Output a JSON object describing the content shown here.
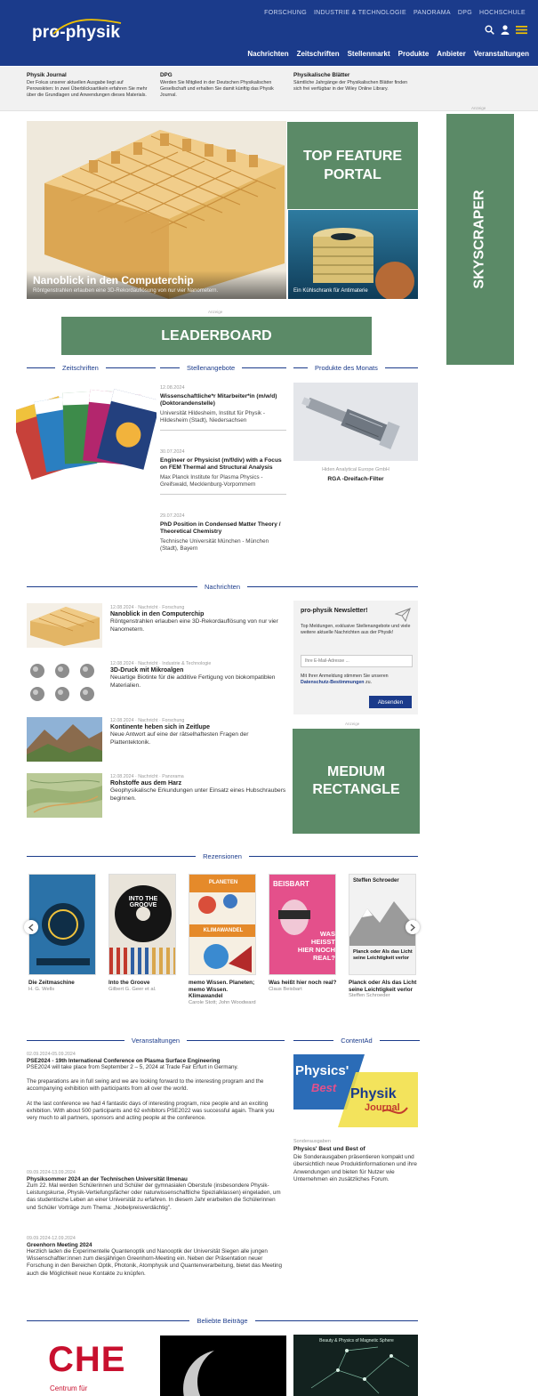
{
  "header": {
    "logo": "pro-physik",
    "top_links": [
      "FORSCHUNG",
      "INDUSTRIE & TECHNOLOGIE",
      "PANORAMA",
      "DPG",
      "HOCHSCHULE"
    ],
    "main_nav": [
      "Nachrichten",
      "Zeitschriften",
      "Stellenmarkt",
      "Produkte",
      "Anbieter",
      "Veranstaltungen"
    ]
  },
  "journal_strip": [
    {
      "title": "Physik Journal",
      "text": "Der Fokus unserer aktuellen Ausgabe liegt auf Perowskiten: In zwei Überblicksartikeln erfahren Sie mehr über die Grundlagen und Anwendungen dieses Materials."
    },
    {
      "title": "DPG",
      "text": "Werden Sie Mitglied in der Deutschen Physikalischen Gesellschaft und erhalten Sie damit künftig das Physik Journal."
    },
    {
      "title": "Physikalische Blätter",
      "text": "Sämtliche Jahrgänge der Physikalischen Blätter finden sich frei verfügbar in der Wiley Online Library."
    }
  ],
  "ad_label": "Anzeige",
  "feature": {
    "main_title": "Nanoblick in den Computerchip",
    "main_subtitle": "Röntgenstrahlen erlauben eine 3D-Rekordauflösung von nur vier Nanometern.",
    "side_caption": "Ein Kühlschrank für Antimaterie"
  },
  "ads": {
    "top_feature": "TOP FEATURE PORTAL",
    "skyscraper": "SKYSCRAPER",
    "leaderboard": "LEADERBOARD",
    "medium_rectangle": "MEDIUM RECTANGLE"
  },
  "sections": {
    "zeitschriften": "Zeitschriften",
    "stellenangebote": "Stellenangebote",
    "produkte": "Produkte des Monats",
    "nachrichten": "Nachrichten",
    "rezensionen": "Rezensionen",
    "veranstaltungen": "Veranstaltungen",
    "contentad": "ContentAd",
    "beliebte": "Beliebte Beiträge"
  },
  "jobs": [
    {
      "date": "12.08.2024",
      "title": "Wissenschaftliche*r Mitarbeiter*in (m/w/d) (Doktorandenstelle)",
      "org": "Universität Hildesheim, Institut für Physik - Hildesheim (Stadt), Niedersachsen"
    },
    {
      "date": "30.07.2024",
      "title": "Engineer or Physicist (m/f/div) with a Focus on FEM Thermal and Structural Analysis",
      "org": "Max Planck Institute for Plasma Physics - Greifswald, Mecklenburg-Vorpommern"
    },
    {
      "date": "29.07.2024",
      "title": "PhD Position in Condensed Matter Theory / Theoretical Chemistry",
      "org": "Technische Universität München - München (Stadt), Bayern"
    }
  ],
  "product": {
    "vendor": "Hiden Analytical Europe GmbH",
    "name": "RGA -Dreifach-Filter"
  },
  "news": [
    {
      "meta": "12.08.2024 · Nachricht · Forschung",
      "title": "Nanoblick in den Computerchip",
      "desc": "Röntgenstrahlen erlauben eine 3D-Rekordauflösung von nur vier Nanometern."
    },
    {
      "meta": "12.08.2024 · Nachricht · Industrie & Technologie",
      "title": "3D-Druck mit Mikroalgen",
      "desc": "Neuartige Biotinte für die additive Fertigung von biokompatiblen Materialien."
    },
    {
      "meta": "12.08.2024 · Nachricht · Forschung",
      "title": "Kontinente heben sich in Zeitlupe",
      "desc": "Neue Antwort auf eine der rätselhaftesten Fragen der Plattentektonik."
    },
    {
      "meta": "12.08.2024 · Nachricht · Panorama",
      "title": "Rohstoffe aus dem Harz",
      "desc": "Geophysikalische Erkundungen unter Einsatz eines Hubschraubers beginnen."
    }
  ],
  "newsletter": {
    "title": "pro-physik Newsletter!",
    "text": "Top Meldungen, exklusive Stellenangebote und viele weitere aktuelle Nachrichten aus der Physik!",
    "placeholder": "Ihre E-Mail-Adresse ...",
    "consent_prefix": "Mit Ihrer Anmeldung stimmen Sie unseren",
    "consent_link": "Datenschutz-Bestimmungen",
    "consent_suffix": "zu.",
    "button": "Absenden"
  },
  "books": [
    {
      "title": "Die Zeitmaschine",
      "author": "H. G. Wells"
    },
    {
      "title": "Into the Groove",
      "author": "Gilbert G. Geer et al."
    },
    {
      "title": "memo Wissen. Planeten; memo Wissen. Klimawandel",
      "author": "Carole Stott; John Woodward"
    },
    {
      "title": "Was heißt hier noch real?",
      "author": "Claus Beisbart"
    },
    {
      "title": "Planck oder Als das Licht seine Leichtigkeit verlor",
      "author": "Steffen Schroeder"
    }
  ],
  "book_covers": {
    "groove": "INTO THE GROOVE",
    "planeten": "PLANETEN",
    "klima": "KLIMAWANDEL",
    "beisbart_author": "BEISBART",
    "beisbart_title": "WAS HEISST HIER NOCH REAL?",
    "schroeder_author": "Steffen Schroeder",
    "schroeder_title": "Planck oder Als das Licht seine Leichtigkeit verlor"
  },
  "events": [
    {
      "date": "02.09.2024-05.09.2024",
      "title": "PSE2024 - 19th International Conference on Plasma Surface Engineering",
      "paras": [
        "PSE2024 will take place from September 2 – 5, 2024 at Trade Fair Erfurt in Germany.",
        "The preparations are in full swing and we are looking forward to the interesting program and the accompanying exhibition with participants from all over the world.",
        "At the last conference we had 4 fantastic days of interesting program, nice people and an exciting exhibition. With about 500 participants and 62 exhibitors PSE2022 was successful again. Thank you very much to all partners, sponsors and acting people at the conference."
      ]
    },
    {
      "date": "09.09.2024-13.09.2024",
      "title": "Physiksommer 2024 an der Technischen Universität Ilmenau",
      "paras": [
        "Zum 22. Mal werden Schülerinnen und Schüler der gymnasialen Oberstufe (insbesondere Physik-Leistungskurse, Physik-Vertiefungsfächer oder naturwissenschaftliche Spezialklassen) eingeladen, um das studentische Leben an einer Universität zu erfahren. In diesem Jahr erarbeiten die Schülerinnen und Schüler Vorträge zum Thema: „Nobelpreisverdächtig\"."
      ]
    },
    {
      "date": "09.09.2024-12.09.2024",
      "title": "Greenhorn Meeting 2024",
      "paras": [
        "Herzlich laden die Experimentelle Quantenoptik und Nanooptik der Universität Siegen alle jungen Wissenschaftler:innen zum diesjährigen Greenhorn-Meeting ein. Neben der Präsentation neuer Forschung in den Bereichen Optik, Photonik, Atomphysik und Quantenverarbeitung, bietet das Meeting auch die Möglichkeit neue Kontakte zu knüpfen."
      ]
    }
  ],
  "contentad": {
    "logo_line1": "Physics'",
    "logo_line2": "Best",
    "logo_line3": "Physik",
    "logo_line4": "Journal",
    "category": "Sonderausgaben",
    "title": "Physics' Best und Best of",
    "desc": "Die Sonderausgaben präsentieren kompakt und übersichtlich neue Produktinformationen und ihre Anwendungen und bieten für Nutzer wie Unternehmen ein zusätzliches Forum."
  },
  "popular": {
    "che_logo": "CHE",
    "che_sub": "Centrum für",
    "dark_title": "Beauty & Physics of Magnetic Sphere"
  },
  "colors": {
    "brand": "#1b3b8b",
    "ad_green": "#5b8a67",
    "text": "#1c1c1c"
  },
  "icons": [
    "search-icon",
    "user-icon",
    "menu-icon",
    "paper-plane-icon",
    "chevron-left-icon",
    "chevron-right-icon"
  ]
}
